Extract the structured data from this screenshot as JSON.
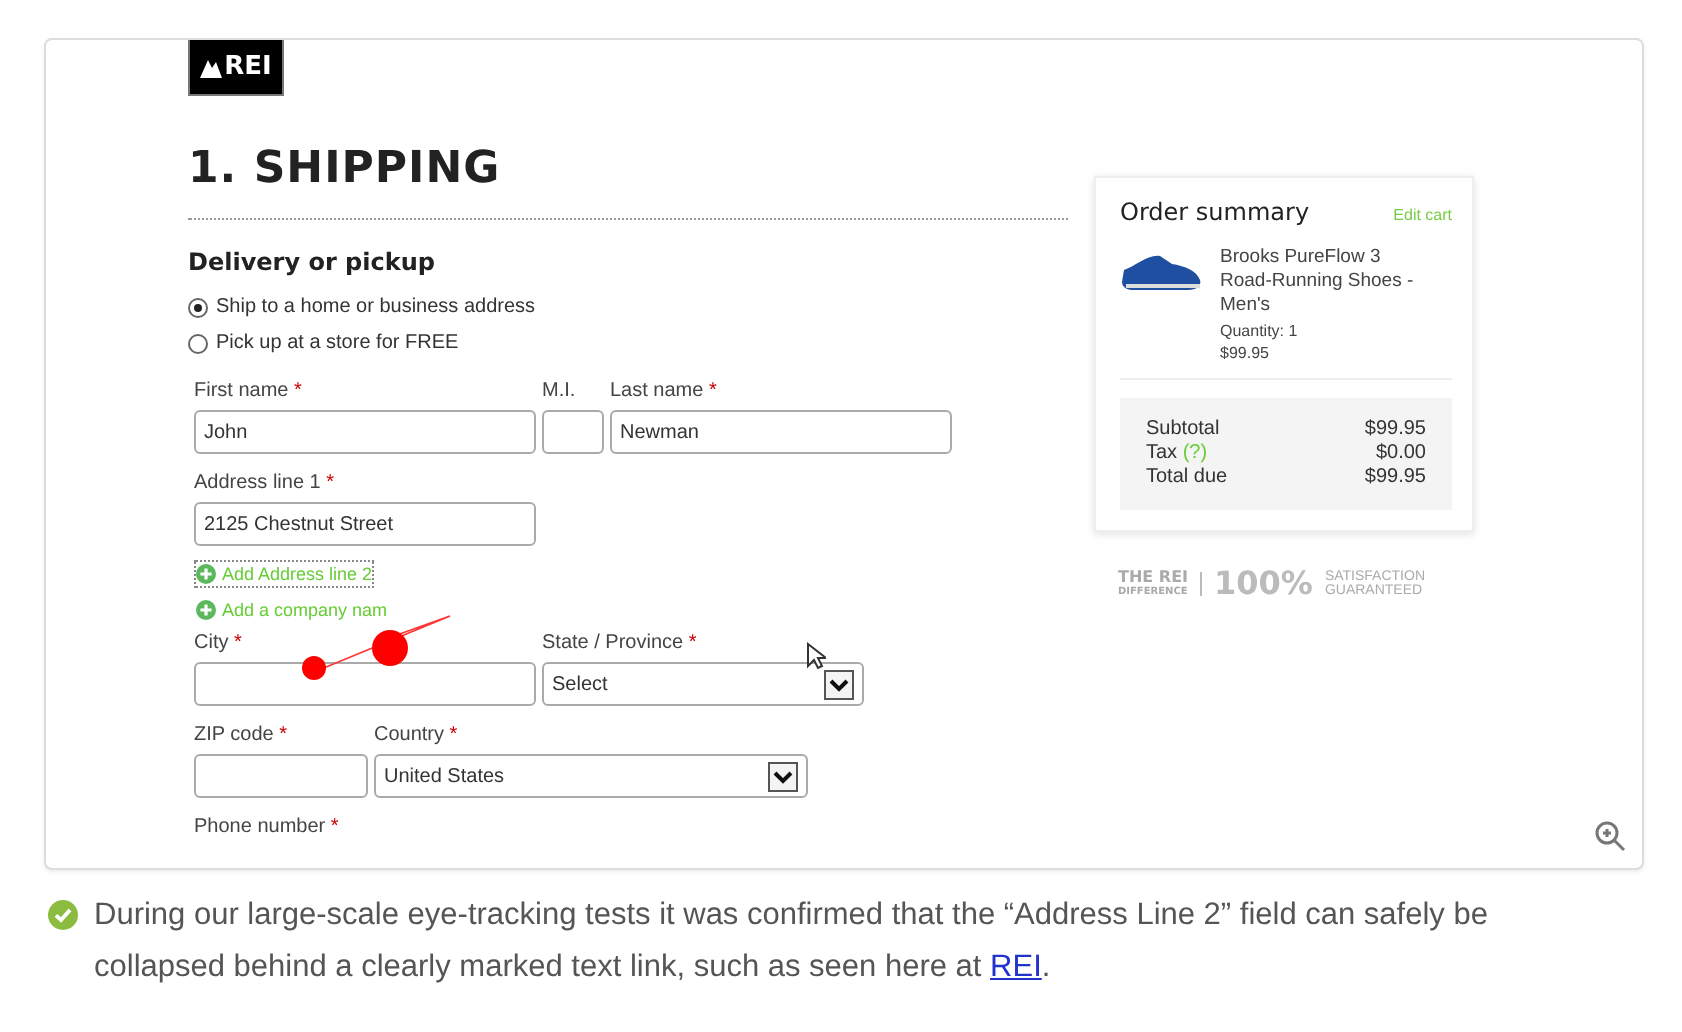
{
  "logo": {
    "text": "REI"
  },
  "heading": "1. SHIPPING",
  "section_title": "Delivery or pickup",
  "delivery_options": [
    {
      "label": "Ship to a home or business address",
      "selected": true
    },
    {
      "label": "Pick up at a store for FREE",
      "selected": false
    }
  ],
  "form_rows": [
    [
      {
        "label": "First name",
        "mark": "*",
        "kind": "text",
        "value": "John"
      },
      {
        "label": "M.I.",
        "kind": "text"
      },
      {
        "label": "Last name",
        "mark": "*",
        "kind": "text",
        "value": "Newman"
      }
    ],
    [
      {
        "label": "Address line 1",
        "mark": "*",
        "kind": "text",
        "value": "2125 Chestnut Street"
      }
    ],
    [
      {
        "label": "City",
        "mark": "*",
        "kind": "text"
      },
      {
        "label": "State / Province",
        "mark": "*",
        "kind": "select",
        "value": "Select"
      }
    ],
    [
      {
        "label": "ZIP code",
        "mark": "*",
        "kind": "text"
      },
      {
        "label": "Country",
        "mark": "*",
        "kind": "select",
        "value": "United States"
      }
    ],
    [
      {
        "label": "Phone number",
        "mark": "*",
        "kind": "label"
      }
    ]
  ],
  "add_links": [
    {
      "label": "Add Address line 2",
      "focused": true
    },
    {
      "label": "Add a company nam",
      "focused": false
    }
  ],
  "order_summary": {
    "title": "Order summary",
    "edit_link": "Edit cart",
    "product": {
      "name": "Brooks PureFlow 3 Road-Running Shoes - Men's",
      "quantity": "Quantity: 1",
      "price": "$99.95"
    },
    "totals": [
      {
        "label": "Subtotal",
        "value": "$99.95"
      },
      {
        "label": "Tax",
        "note": "(?)",
        "value": "$0.00"
      },
      {
        "label": "Total due",
        "value": "$99.95"
      }
    ]
  },
  "guarantee": {
    "brand": "THE REI",
    "brand_sub": "DIFFERENCE",
    "percent": "100%",
    "line_1": "SATISFACTION",
    "line_2": "GUARANTEED"
  },
  "caption": {
    "text": "During our large-scale eye-tracking tests it was confirmed that the “Address Line 2” field can safely be collapsed behind a clearly marked text link, such as seen here at ",
    "link": "REI",
    "after": "."
  }
}
